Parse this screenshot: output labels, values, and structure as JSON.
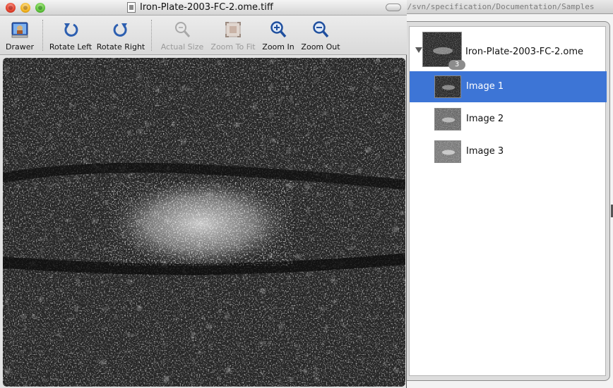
{
  "background_window": {
    "path_text": "k/svn/specification/Documentation/Samples"
  },
  "window": {
    "title": "Iron-Plate-2003-FC-2.ome.tiff"
  },
  "toolbar": {
    "items": [
      {
        "label": "Drawer",
        "icon": "drawer-icon",
        "enabled": true
      },
      {
        "label": "Rotate Left",
        "icon": "rotate-left-icon",
        "enabled": true
      },
      {
        "label": "Rotate Right",
        "icon": "rotate-right-icon",
        "enabled": true
      },
      {
        "label": "Actual Size",
        "icon": "actual-size-icon",
        "enabled": false
      },
      {
        "label": "Zoom To Fit",
        "icon": "zoom-to-fit-icon",
        "enabled": false
      },
      {
        "label": "Zoom In",
        "icon": "zoom-in-icon",
        "enabled": true
      },
      {
        "label": "Zoom Out",
        "icon": "zoom-out-icon",
        "enabled": true
      }
    ]
  },
  "drawer": {
    "parent": {
      "label": "Iron-Plate-2003-FC-2.ome",
      "count": "3",
      "expanded": true
    },
    "images": [
      {
        "label": "Image 1",
        "selected": true
      },
      {
        "label": "Image 2",
        "selected": false
      },
      {
        "label": "Image 3",
        "selected": false
      }
    ]
  },
  "colors": {
    "selection": "#3d75d6",
    "canvas": "#000000"
  }
}
